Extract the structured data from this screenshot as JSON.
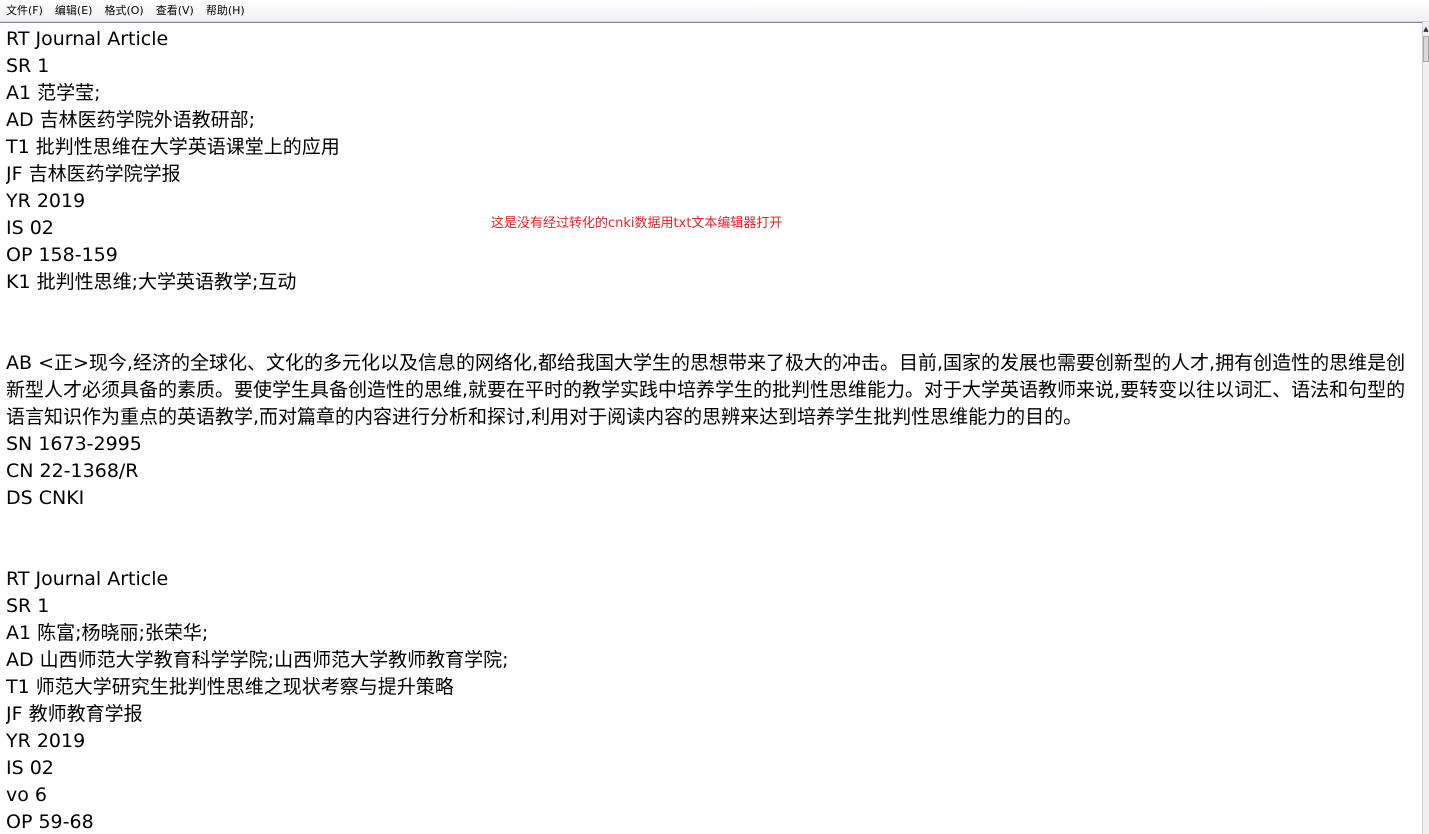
{
  "menu": {
    "file": "文件(F)",
    "edit": "编辑(E)",
    "format": "格式(O)",
    "view": "查看(V)",
    "help": "帮助(H)"
  },
  "annotation": "这是没有经过转化的cnki数据用txt文本编辑器打开",
  "content": {
    "lines": [
      "RT Journal Article",
      "SR 1",
      "A1 范学莹;",
      "AD 吉林医药学院外语教研部;",
      "T1 批判性思维在大学英语课堂上的应用",
      "JF 吉林医药学院学报",
      "YR 2019",
      "IS 02",
      "OP 158-159",
      "K1 批判性思维;大学英语教学;互动",
      "",
      "",
      "AB <正>现今,经济的全球化、文化的多元化以及信息的网络化,都给我国大学生的思想带来了极大的冲击。目前,国家的发展也需要创新型的人才,拥有创造性的思维是创新型人才必须具备的素质。要使学生具备创造性的思维,就要在平时的教学实践中培养学生的批判性思维能力。对于大学英语教师来说,要转变以往以词汇、语法和句型的语言知识作为重点的英语教学,而对篇章的内容进行分析和探讨,利用对于阅读内容的思辨来达到培养学生批判性思维能力的目的。",
      "SN 1673-2995",
      "CN 22-1368/R",
      "DS CNKI",
      "",
      "",
      "RT Journal Article",
      "SR 1",
      "A1 陈富;杨晓丽;张荣华;",
      "AD 山西师范大学教育科学学院;山西师范大学教师教育学院;",
      "T1 师范大学研究生批判性思维之现状考察与提升策略",
      "JF 教师教育学报",
      "YR 2019",
      "IS 02",
      "vo 6",
      "OP 59-68"
    ]
  }
}
